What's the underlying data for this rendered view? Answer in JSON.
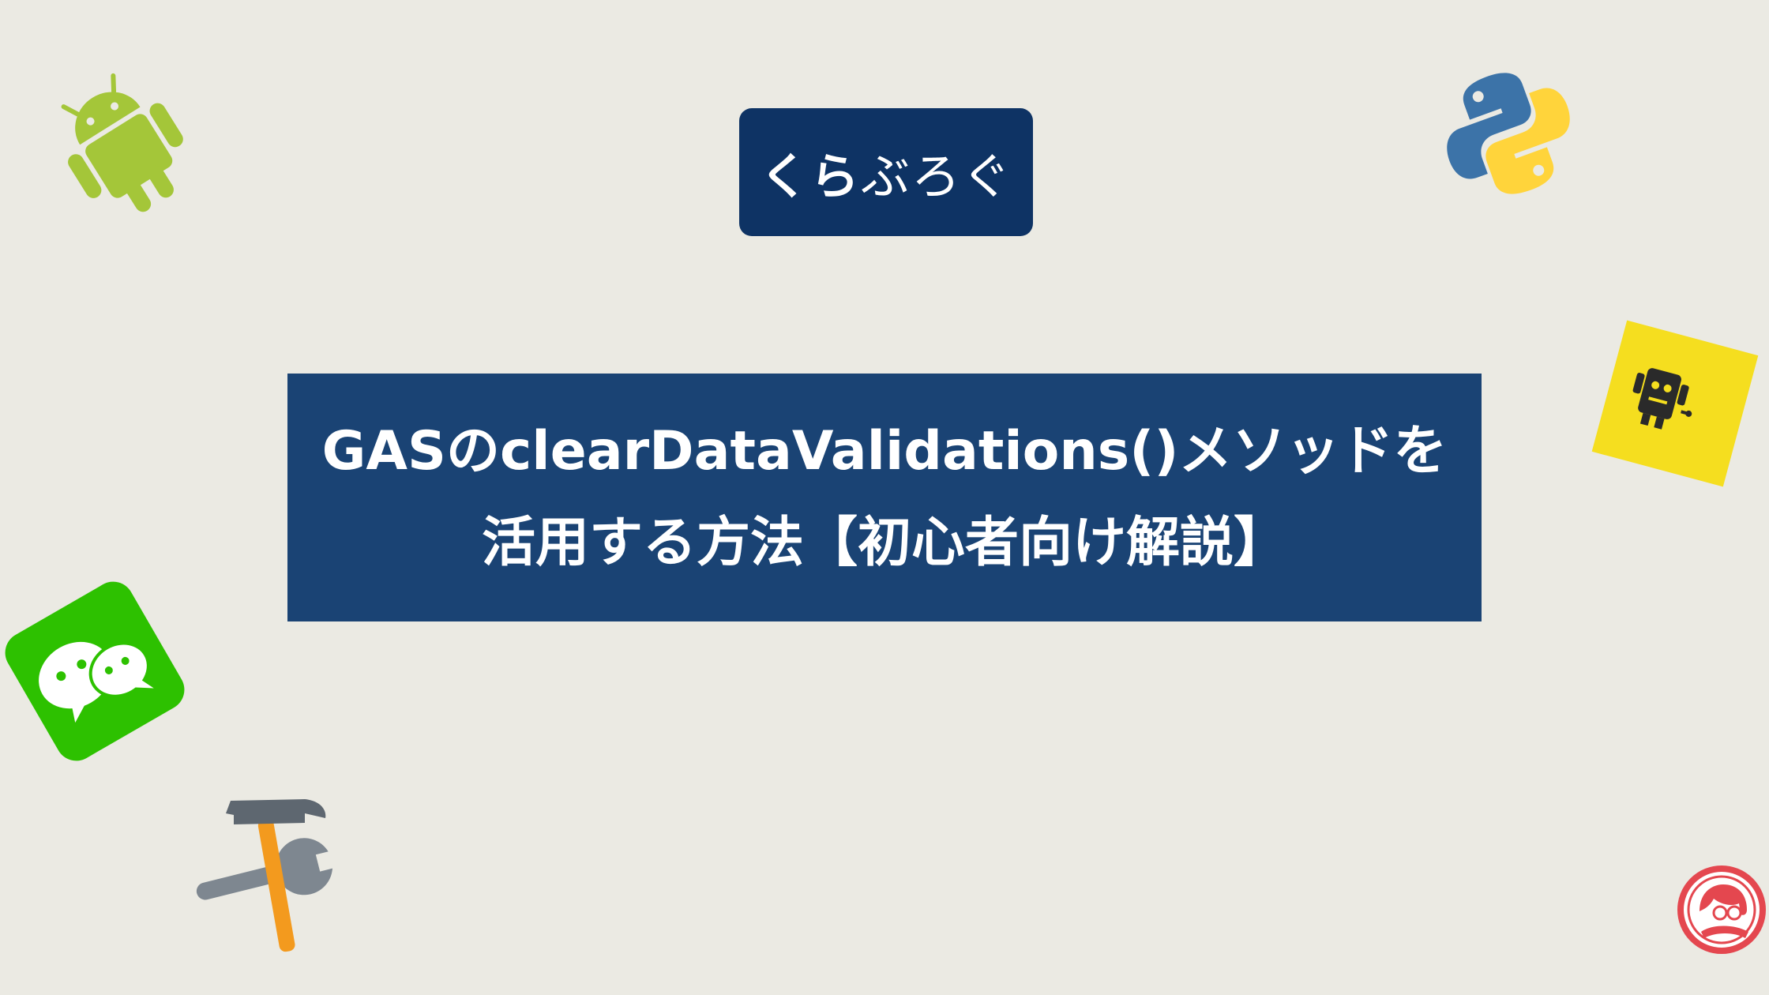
{
  "logo": {
    "strong": "くら",
    "light": "ぶろぐ"
  },
  "title": {
    "line1": "GASのclearDataValidations()メソッドを",
    "line2": "活用する方法【初心者向け解説】"
  },
  "colors": {
    "background": "#EBEAE3",
    "logo_box": "#0E3364",
    "title_box": "#1A4374",
    "android_green": "#A4C639",
    "python_blue": "#3C73A8",
    "python_yellow": "#FFD43B",
    "wechat_green": "#2DC100",
    "sticky_yellow": "#F5DE1F",
    "hammer_orange": "#F39A1E",
    "tool_gray": "#7E8790",
    "badge_red": "#E4474F"
  },
  "icons": [
    "android-icon",
    "python-icon",
    "robot-sticky-note-icon",
    "wechat-icon",
    "hammer-wrench-icon",
    "author-avatar-badge-icon"
  ]
}
